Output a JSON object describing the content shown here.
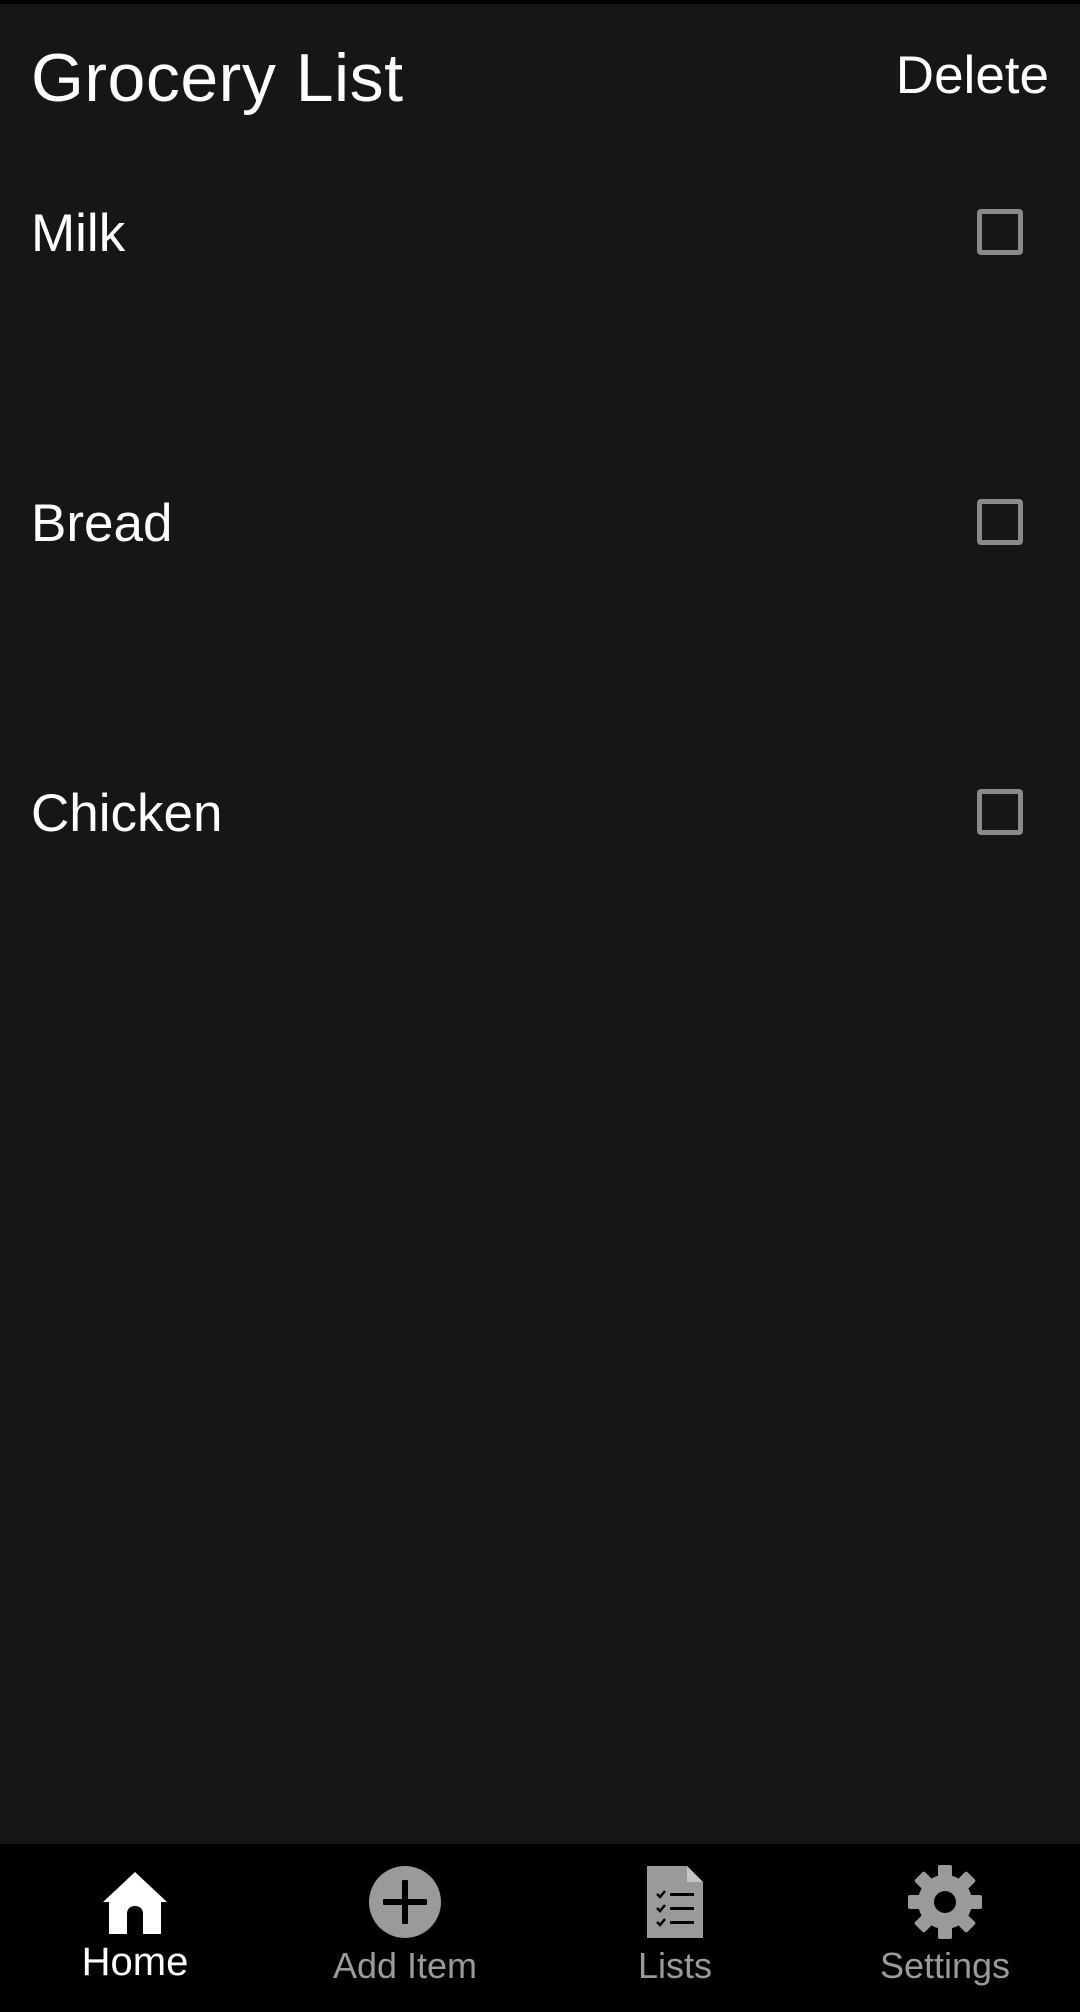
{
  "header": {
    "title": "Grocery List",
    "delete_label": "Delete"
  },
  "items": [
    {
      "label": "Milk",
      "checked": false
    },
    {
      "label": "Bread",
      "checked": false
    },
    {
      "label": "Chicken",
      "checked": false
    }
  ],
  "nav": [
    {
      "label": "Home",
      "icon": "home-icon",
      "active": true
    },
    {
      "label": "Add Item",
      "icon": "add-circle-icon",
      "active": false
    },
    {
      "label": "Lists",
      "icon": "checklist-document-icon",
      "active": false
    },
    {
      "label": "Settings",
      "icon": "gear-icon",
      "active": false
    }
  ],
  "colors": {
    "background": "#161616",
    "nav_background": "#000000",
    "active": "#ffffff",
    "inactive": "#9a9a9a",
    "checkbox_border": "#8a8a8a"
  }
}
